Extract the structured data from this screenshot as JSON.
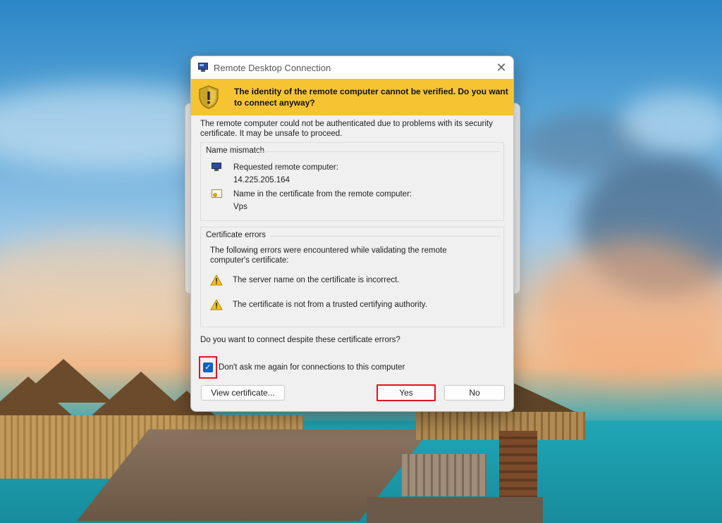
{
  "dialog": {
    "title": "Remote Desktop Connection",
    "close_glyph": "✕",
    "banner_text": "The identity of the remote computer cannot be verified. Do you want to connect anyway?",
    "intro_text": "The remote computer could not be authenticated due to problems with its security certificate. It may be unsafe to proceed.",
    "name_mismatch": {
      "label": "Name mismatch",
      "requested_label": "Requested remote computer:",
      "requested_value": "14.225.205.164",
      "cert_name_label": "Name in the certificate from the remote computer:",
      "cert_name_value": "Vps"
    },
    "certificate_errors": {
      "label": "Certificate errors",
      "description": "The following errors were encountered while validating the remote computer's certificate:",
      "errors": [
        "The server name on the certificate is incorrect.",
        "The certificate is not from a trusted certifying authority."
      ]
    },
    "question": "Do you want to connect despite these certificate errors?",
    "checkbox": {
      "label": "Don't ask me again for connections to this computer",
      "checked": true,
      "check_glyph": "✓"
    },
    "buttons": {
      "view_certificate": "View certificate...",
      "yes": "Yes",
      "no": "No"
    }
  },
  "icons": {
    "app": "remote-desktop-icon",
    "banner": "warning-shield-icon",
    "computer": "computer-icon",
    "certificate": "certificate-icon",
    "warning": "warning-triangle-icon"
  },
  "colors": {
    "banner_bg": "#f6c433",
    "highlight_red": "#e0141e",
    "checkbox_blue": "#0a64c8"
  }
}
